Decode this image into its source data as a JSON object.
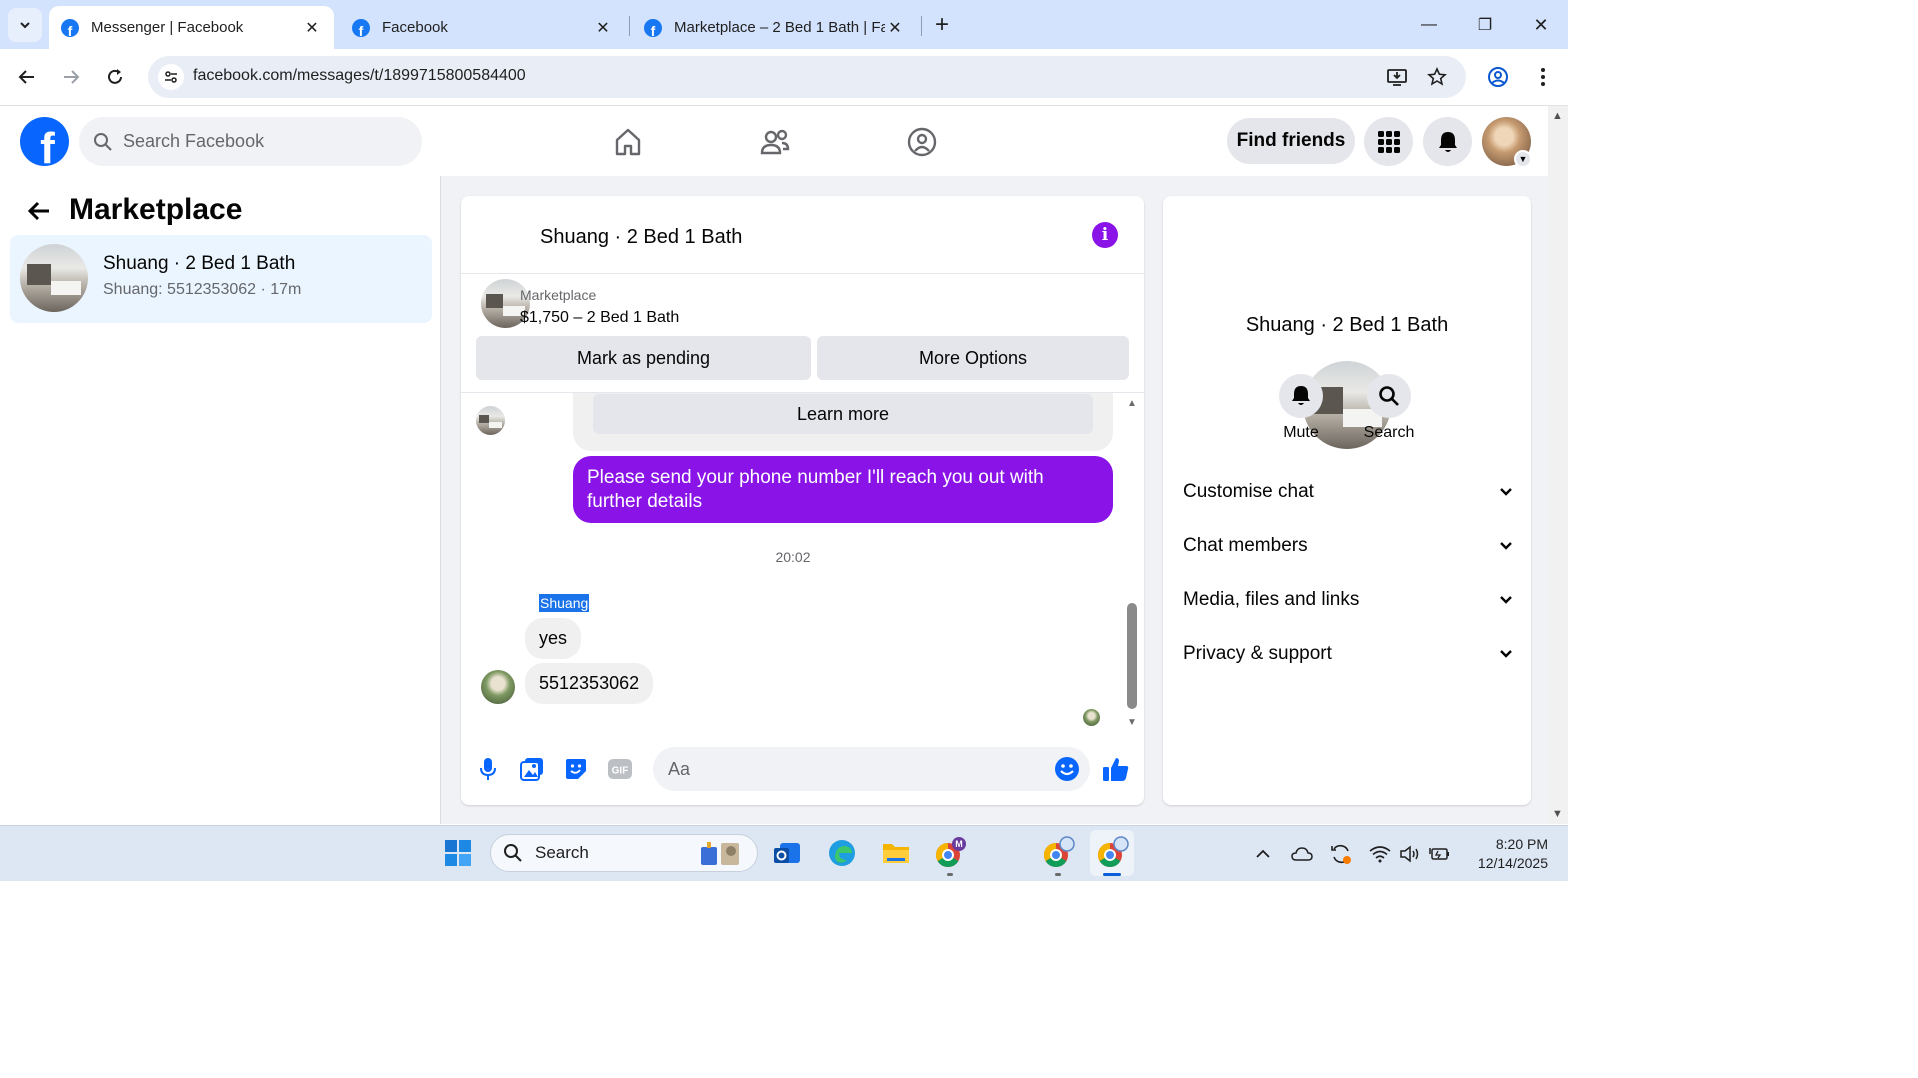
{
  "browser": {
    "tabs": [
      {
        "title": "Messenger | Facebook",
        "active": true
      },
      {
        "title": "Facebook",
        "active": false
      },
      {
        "title": "Marketplace – 2 Bed 1 Bath | Fa",
        "active": false
      }
    ],
    "close_glyph": "✕",
    "new_tab_glyph": "+",
    "url": "facebook.com/messages/t/1899715800584400",
    "window_controls": {
      "minimize": "—",
      "restore": "❐",
      "close": "✕"
    }
  },
  "fb_header": {
    "logo_letter": "f",
    "search_placeholder": "Search Facebook",
    "find_friends": "Find friends",
    "brand_color": "#0866ff"
  },
  "left_panel": {
    "title": "Marketplace",
    "conversations": [
      {
        "name": "Shuang · 2 Bed 1 Bath",
        "preview": "Shuang: 5512353062 · 17m"
      }
    ]
  },
  "chat": {
    "header_title": "Shuang · 2 Bed 1 Bath",
    "info_glyph": "i",
    "listing_label": "Marketplace",
    "listing_price": "$1,750 – 2 Bed 1 Bath",
    "mark_pending": "Mark as pending",
    "more_options": "More Options",
    "learn_more": "Learn more",
    "outgoing_message": "Please send your phone number  I'll reach you out with further details",
    "timestamp": "20:02",
    "sender_name": "Shuang",
    "incoming_messages": [
      "yes",
      "5512353062"
    ],
    "composer_placeholder": "Aa",
    "accent_color": "#8a13e8"
  },
  "right_panel": {
    "name": "Shuang · 2 Bed 1 Bath",
    "actions": [
      "Mute",
      "Search"
    ],
    "sections": [
      "Customise chat",
      "Chat members",
      "Media, files and links",
      "Privacy & support"
    ]
  },
  "taskbar": {
    "search_label": "Search",
    "time": "8:20 PM",
    "date": "12/14/2025"
  }
}
